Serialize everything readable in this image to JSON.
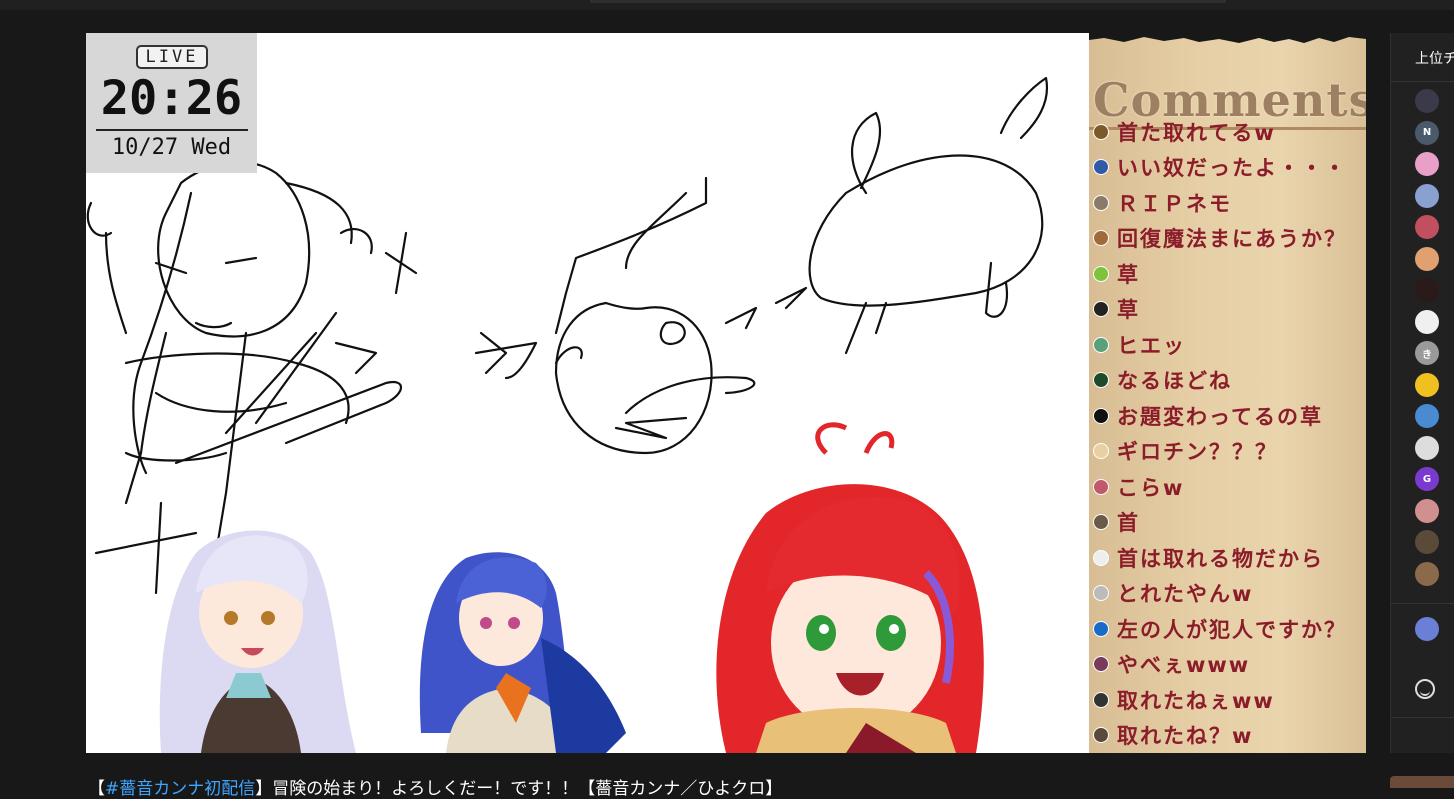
{
  "overlay": {
    "live_label": "LIVE",
    "time": "20:26",
    "date": "10/27 Wed"
  },
  "comments_panel": {
    "title": "Comments",
    "comments": [
      {
        "text": "首た取れてるw",
        "icon_color": "#7a5a2a"
      },
      {
        "text": "いい奴だったよ・・・",
        "icon_color": "#2f5aa8"
      },
      {
        "text": "ＲＩＰネモ",
        "icon_color": "#8a7a6a"
      },
      {
        "text": "回復魔法まにあうか？",
        "icon_color": "#a06a3a"
      },
      {
        "text": "草",
        "icon_color": "#7cc43a"
      },
      {
        "text": "草",
        "icon_color": "#222222"
      },
      {
        "text": "ヒエッ",
        "icon_color": "#5aa07a"
      },
      {
        "text": "なるほどね",
        "icon_color": "#1f4a2a"
      },
      {
        "text": "お題変わってるの草",
        "icon_color": "#111111"
      },
      {
        "text": "ギロチン？？？",
        "icon_color": "#e8d0a0"
      },
      {
        "text": "こらw",
        "icon_color": "#c05a6a"
      },
      {
        "text": "首",
        "icon_color": "#6a5a4a"
      },
      {
        "text": "首は取れる物だから",
        "icon_color": "#eeeeee"
      },
      {
        "text": "とれたやんw",
        "icon_color": "#bbbbbb"
      },
      {
        "text": "左の人が犯人ですか？",
        "icon_color": "#1a6ac8"
      },
      {
        "text": "やべぇwww",
        "icon_color": "#7a3a5a"
      },
      {
        "text": "取れたねぇww",
        "icon_color": "#333333"
      },
      {
        "text": "取れたね？w",
        "icon_color": "#5a4a3a"
      }
    ]
  },
  "side_chat": {
    "title": "上位チ",
    "avatars": [
      {
        "color": "#3a3a4a",
        "letter": ""
      },
      {
        "color": "#4a5a6a",
        "letter": "N"
      },
      {
        "color": "#e8a0c8",
        "letter": ""
      },
      {
        "color": "#8aa0d0",
        "letter": ""
      },
      {
        "color": "#c05060",
        "letter": ""
      },
      {
        "color": "#e0a070",
        "letter": ""
      },
      {
        "color": "#2a1a1a",
        "letter": ""
      },
      {
        "color": "#f0f0f0",
        "letter": ""
      },
      {
        "color": "#9a9a9a",
        "letter": "き"
      },
      {
        "color": "#f0c020",
        "letter": ""
      },
      {
        "color": "#4a8ad0",
        "letter": ""
      },
      {
        "color": "#dddddd",
        "letter": ""
      },
      {
        "color": "#7a3ad0",
        "letter": "G"
      },
      {
        "color": "#d09090",
        "letter": ""
      },
      {
        "color": "#5a4a3a",
        "letter": ""
      },
      {
        "color": "#8a6a4a",
        "letter": ""
      }
    ]
  },
  "video": {
    "title_tag": "#薔音カンナ初配信",
    "title_rest": "冒険の始まり！よろしくだー！です！！【薔音カンナ／ひよクロ】",
    "title_open": "【",
    "title_close": "】"
  },
  "colors": {
    "comment_text": "#8b1c2a",
    "panel_parchment": "#e6cfa6",
    "link_blue": "#3ea6ff"
  }
}
